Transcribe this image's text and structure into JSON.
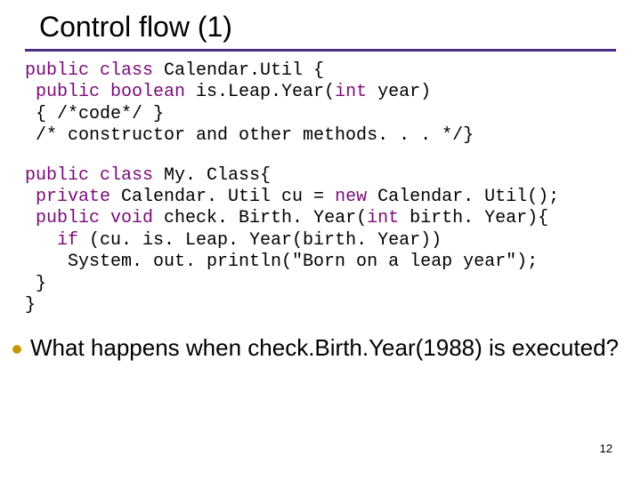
{
  "title": "Control flow (1)",
  "code1": {
    "l1a": "public",
    "l1b": " class",
    "l1c": " Calendar.Util {",
    "l2a": " public",
    "l2b": " boolean",
    "l2c": " is.Leap.Year(",
    "l2d": "int",
    "l2e": " year)",
    "l3": " { /*code*/ }",
    "l4": " /* constructor and other methods. . . */}"
  },
  "code2": {
    "l1a": "public",
    "l1b": " class",
    "l1c": " My. Class{",
    "l2a": " private",
    "l2b": " Calendar. Util cu = ",
    "l2c": "new",
    "l2d": " Calendar. Util();",
    "l3a": " public",
    "l3b": " void",
    "l3c": " check. Birth. Year(",
    "l3d": "int",
    "l3e": " birth. Year){",
    "l4a": "   if",
    "l4b": " (cu. is. Leap. Year(birth. Year))",
    "l5": "    System. out. println(\"Born on a leap year\");",
    "l6": " }",
    "l7": "}"
  },
  "question": "What happens when check.Birth.Year(1988) is executed?",
  "pagenum": "12"
}
